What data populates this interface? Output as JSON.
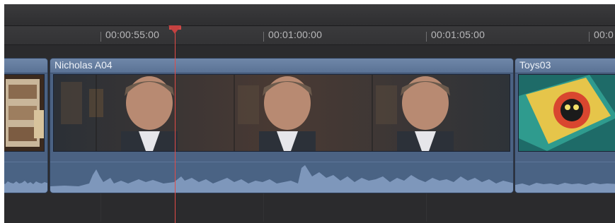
{
  "timeline": {
    "ruler_labels": [
      "00:00:55:00",
      "00:01:00:00",
      "00:01:05:00",
      "00:0"
    ],
    "playhead_color": "#e24b47"
  },
  "clips": [
    {
      "title": "Nicholas A04",
      "kind": "video-with-audio"
    },
    {
      "title": "Toys03",
      "kind": "video-with-audio"
    }
  ],
  "colors": {
    "clip_body": "#4b6283",
    "clip_header": "#6f87a8",
    "background": "#2a2a2c",
    "waveform": "#7e97bb"
  }
}
